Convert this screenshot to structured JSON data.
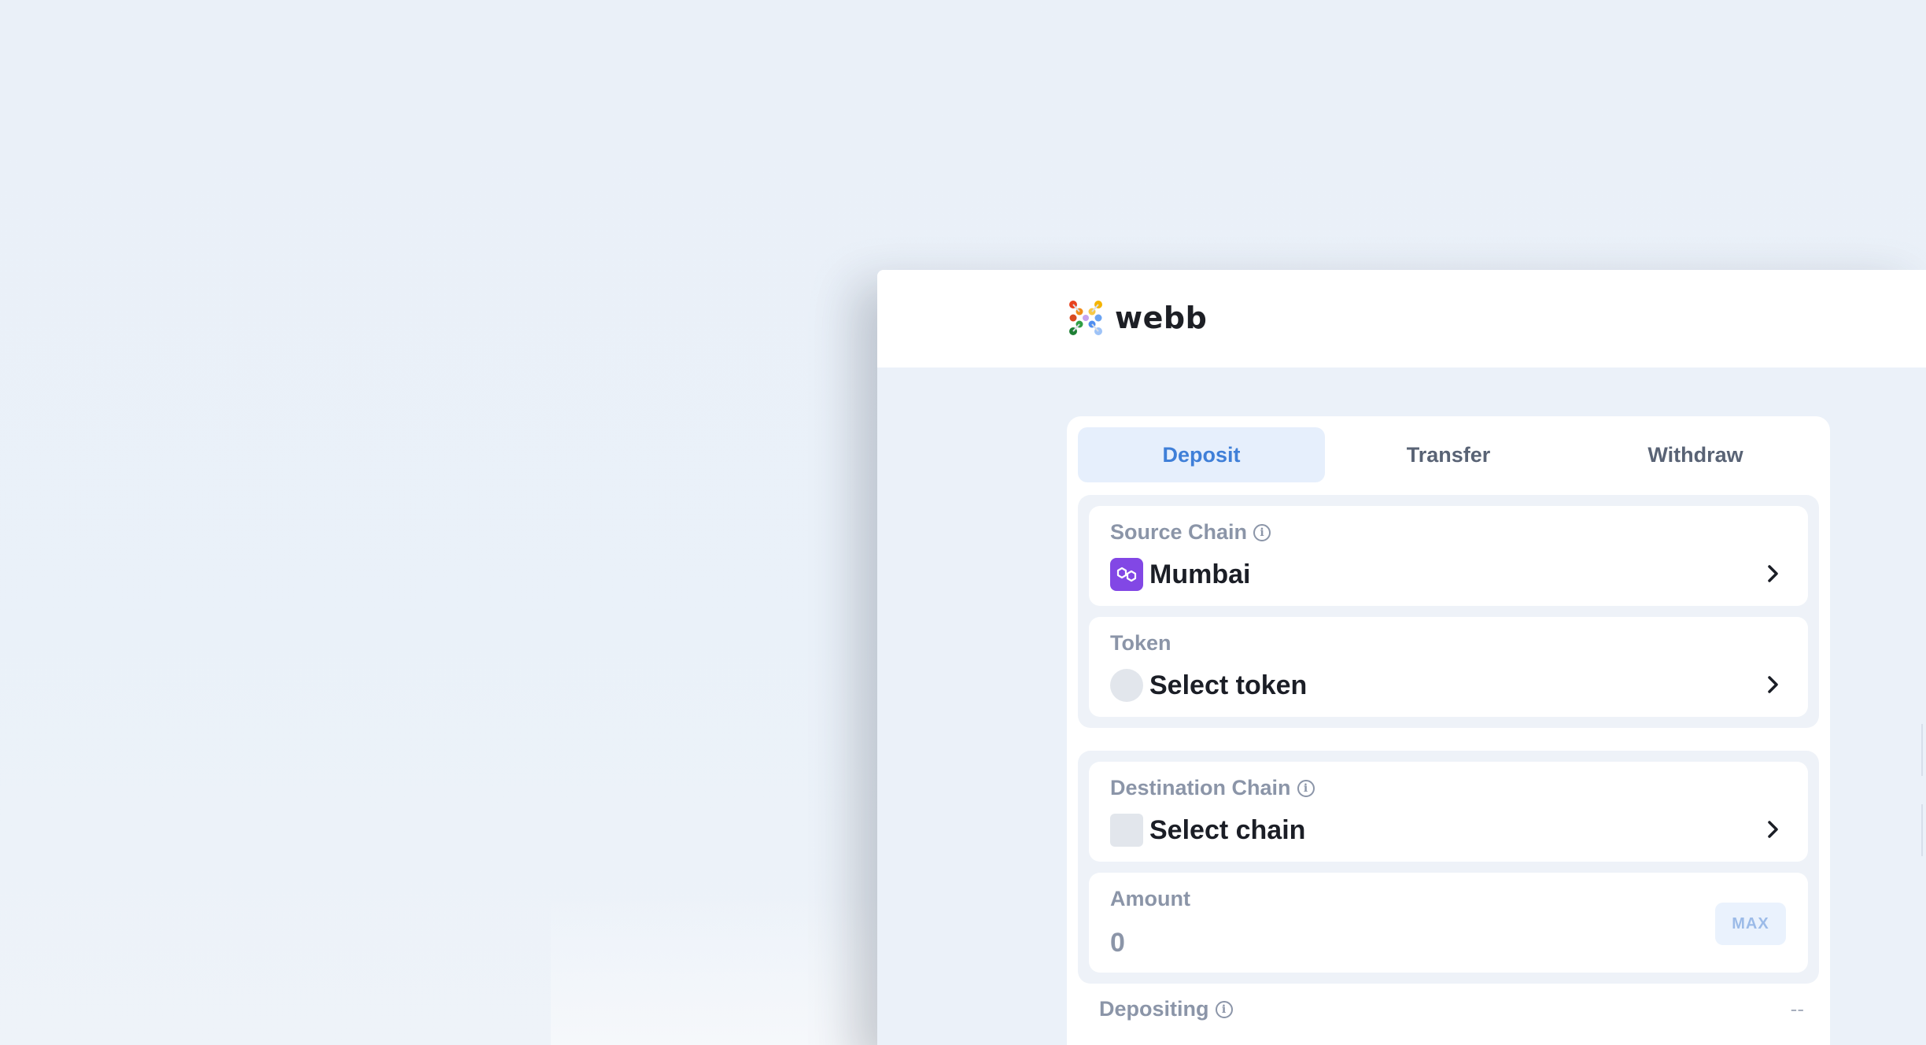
{
  "brand": {
    "name": "webb",
    "logo_icon": "webb-logo-icon"
  },
  "tabs": [
    {
      "label": "Deposit",
      "active": true
    },
    {
      "label": "Transfer",
      "active": false
    },
    {
      "label": "Withdraw",
      "active": false
    }
  ],
  "source_chain": {
    "label": "Source Chain",
    "value": "Mumbai",
    "icon": "polygon-chain-icon",
    "badge_color": "#8247e5"
  },
  "token": {
    "label": "Token",
    "value": "Select token"
  },
  "destination_chain": {
    "label": "Destination Chain",
    "value": "Select chain"
  },
  "amount": {
    "label": "Amount",
    "value": "0",
    "max_label": "MAX"
  },
  "summary": {
    "label": "Depositing",
    "value": "--"
  },
  "colors": {
    "accent": "#3f7fd8",
    "active_tab_bg": "#e6effc",
    "background": "#eaf0f8"
  }
}
